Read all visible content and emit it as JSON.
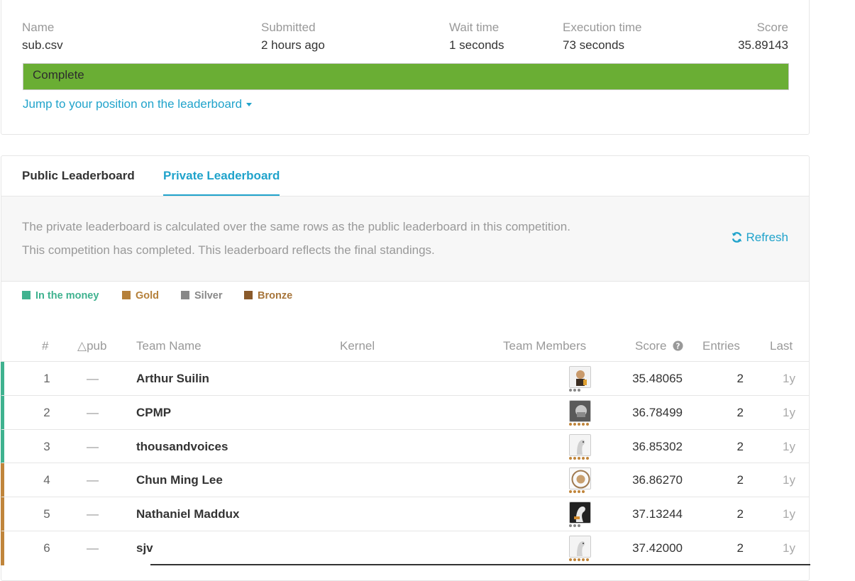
{
  "submission": {
    "headers": {
      "name": "Name",
      "submitted": "Submitted",
      "wait": "Wait time",
      "exec": "Execution time",
      "score": "Score"
    },
    "values": {
      "name": "sub.csv",
      "submitted": "2 hours ago",
      "wait": "1 seconds",
      "exec": "73 seconds",
      "score": "35.89143"
    },
    "status": "Complete",
    "status_color": "#6aae34",
    "jump_link": "Jump to your position on the leaderboard"
  },
  "tabs": {
    "public": "Public Leaderboard",
    "private": "Private Leaderboard",
    "active": "private"
  },
  "info": {
    "line1": "The private leaderboard is calculated over the same rows as the public leaderboard in this competition.",
    "line2": "This competition has completed. This leaderboard reflects the final standings.",
    "refresh": "Refresh",
    "refresh_icon": "refresh-icon"
  },
  "legend": [
    {
      "label": "In the money",
      "color": "#3fb28f"
    },
    {
      "label": "Gold",
      "color": "#b5803a"
    },
    {
      "label": "Silver",
      "color": "#888888"
    },
    {
      "label": "Bronze",
      "color": "#8a5a2b"
    }
  ],
  "table": {
    "headers": {
      "rank": "#",
      "delta": "△pub",
      "team": "Team Name",
      "kernel": "Kernel",
      "members": "Team Members",
      "score": "Score",
      "entries": "Entries",
      "last": "Last"
    },
    "rows": [
      {
        "rank": "1",
        "delta": "—",
        "team": "Arthur Suilin",
        "score": "35.48065",
        "entries": "2",
        "last": "1y",
        "tier": "money",
        "dots": 3,
        "dot_color": "#888888"
      },
      {
        "rank": "2",
        "delta": "—",
        "team": "CPMP",
        "score": "36.78499",
        "entries": "2",
        "last": "1y",
        "tier": "money",
        "dots": 5,
        "dot_color": "#c0853b"
      },
      {
        "rank": "3",
        "delta": "—",
        "team": "thousandvoices",
        "score": "36.85302",
        "entries": "2",
        "last": "1y",
        "tier": "money",
        "dots": 5,
        "dot_color": "#c0853b"
      },
      {
        "rank": "4",
        "delta": "—",
        "team": "Chun Ming Lee",
        "score": "36.86270",
        "entries": "2",
        "last": "1y",
        "tier": "gold",
        "dots": 4,
        "dot_color": "#c0853b"
      },
      {
        "rank": "5",
        "delta": "—",
        "team": "Nathaniel Maddux",
        "score": "37.13244",
        "entries": "2",
        "last": "1y",
        "tier": "gold",
        "dots": 3,
        "dot_color": "#888888"
      },
      {
        "rank": "6",
        "delta": "—",
        "team": "sjv",
        "score": "37.42000",
        "entries": "2",
        "last": "1y",
        "tier": "gold",
        "dots": 5,
        "dot_color": "#c0853b"
      }
    ]
  },
  "tier_colors": {
    "money": "#3fb28f",
    "gold": "#c0853b"
  }
}
